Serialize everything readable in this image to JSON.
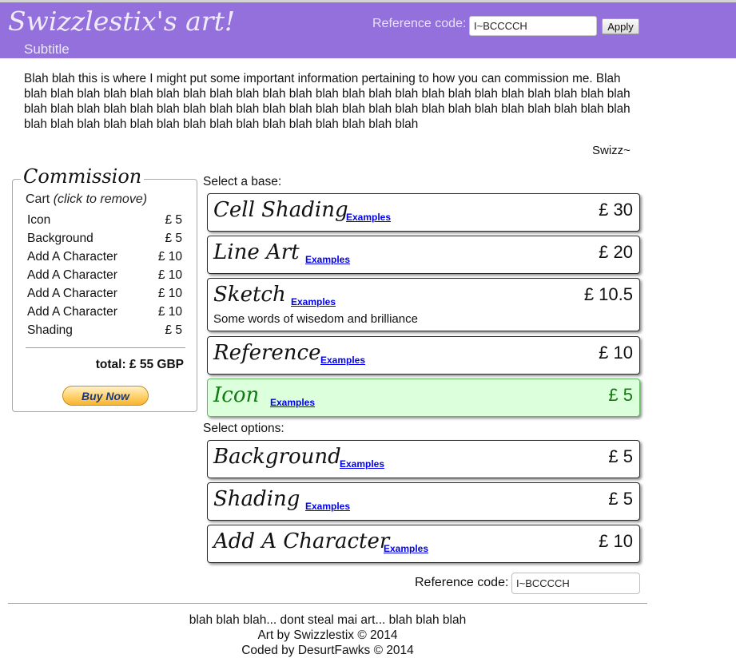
{
  "header": {
    "title": "Swizzlestix's art!",
    "subtitle": "Subtitle",
    "ref_label": "Reference code:",
    "ref_value": "I~BCCCCH",
    "apply_label": "Apply"
  },
  "intro": {
    "text": "Blah blah this is where I might put some important information pertaining to how you can commission me. Blah blah blah blah blah blah blah blah blah blah blah blah blah blah blah blah blah blah blah blah blah blah blah blah blah blah blah blah blah blah blah blah blah blah blah blah blah blah blah blah blah blah blah blah blah blah blah blah blah blah blah blah blah blah blah blah blah blah blah blah blah blah",
    "signature": "Swizz~"
  },
  "commission": {
    "legend": "Commission",
    "cart_label": "Cart",
    "cart_hint": "(click to remove)",
    "items": [
      {
        "name": "Icon",
        "price": "£ 5"
      },
      {
        "name": "Background",
        "price": "£ 5"
      },
      {
        "name": "Add A Character",
        "price": "£ 10"
      },
      {
        "name": "Add A Character",
        "price": "£ 10"
      },
      {
        "name": "Add A Character",
        "price": "£ 10"
      },
      {
        "name": "Add A Character",
        "price": "£ 10"
      },
      {
        "name": "Shading",
        "price": "£ 5"
      }
    ],
    "total": "total: £ 55 GBP",
    "buy_now": "Buy Now"
  },
  "bases": {
    "label": "Select a base:",
    "items": [
      {
        "name": "Cell Shading",
        "link": "Examples",
        "price": "£ 30"
      },
      {
        "name": "Line Art",
        "link": "Examples",
        "price": "£ 20"
      },
      {
        "name": "Sketch",
        "link": "Examples",
        "price": "£ 10.5",
        "desc": "Some words of wisedom and brilliance"
      },
      {
        "name": "Reference",
        "link": "Examples",
        "price": "£ 10"
      },
      {
        "name": "Icon",
        "link": "Examples",
        "price": "£ 5",
        "selected": true
      }
    ]
  },
  "options": {
    "label": "Select options:",
    "items": [
      {
        "name": "Background",
        "link": "Examples",
        "price": "£ 5"
      },
      {
        "name": "Shading",
        "link": "Examples",
        "price": "£ 5"
      },
      {
        "name": "Add A Character",
        "link": "Examples",
        "price": "£ 10"
      }
    ]
  },
  "bottom_ref": {
    "label": "Reference code:",
    "value": "I~BCCCCH"
  },
  "footer": {
    "line1": "blah blah blah... dont steal mai art... blah blah blah",
    "line2": "Art by Swizzlestix © 2014",
    "line3": "Coded by DesurtFawks © 2014"
  },
  "colors": {
    "header_bg": "#9370db",
    "selected_bg": "#dcffdc",
    "selected_text": "#137a13",
    "link": "#0000ee"
  }
}
